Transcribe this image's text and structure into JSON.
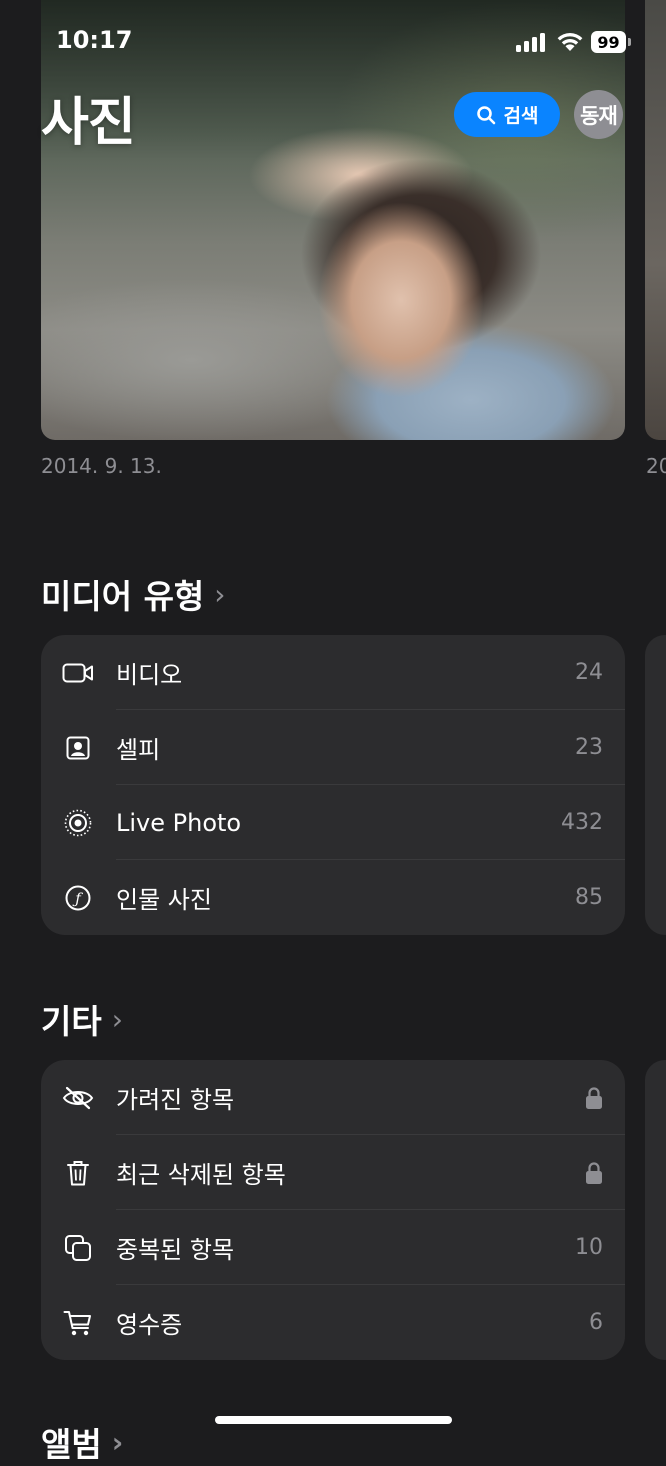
{
  "status_bar": {
    "time": "10:17",
    "battery": "99"
  },
  "header": {
    "title": "사진",
    "search_label": "검색",
    "avatar_text": "동재"
  },
  "featured": {
    "date": "2014. 9. 13.",
    "next_date": "20"
  },
  "media_types": {
    "title": "미디어 유형",
    "items": [
      {
        "icon": "video-icon",
        "label": "비디오",
        "count": "24"
      },
      {
        "icon": "selfie-icon",
        "label": "셀피",
        "count": "23"
      },
      {
        "icon": "live-photo-icon",
        "label": "Live Photo",
        "count": "432"
      },
      {
        "icon": "portrait-icon",
        "label": "인물 사진",
        "count": "85"
      }
    ]
  },
  "utilities": {
    "title": "기타",
    "items": [
      {
        "icon": "hidden-eye-icon",
        "label": "가려진 항목",
        "locked": true
      },
      {
        "icon": "trash-icon",
        "label": "최근 삭제된 항목",
        "locked": true
      },
      {
        "icon": "duplicates-icon",
        "label": "중복된 항목",
        "count": "10"
      },
      {
        "icon": "cart-icon",
        "label": "영수증",
        "count": "6"
      }
    ]
  },
  "albums": {
    "title": "앨범"
  },
  "colors": {
    "accent": "#0a84ff",
    "background": "#1c1c1e",
    "card": "#2c2c2e",
    "secondary_text": "#8e8e93"
  }
}
